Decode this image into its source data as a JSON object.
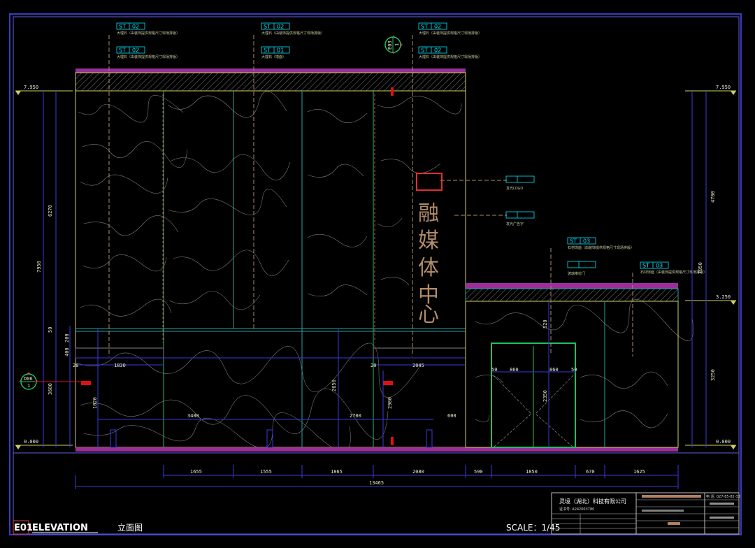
{
  "drawing": {
    "code": "E01",
    "title_en": "ELEVATION",
    "title_cn": "立面图",
    "scale": "SCALE：1/45"
  },
  "big_text": [
    "融",
    "媒",
    "体",
    "中",
    "心"
  ],
  "levels": {
    "top": "7.950",
    "mid": "3.250",
    "ground": "0.000"
  },
  "material_tags": [
    {
      "code": "ST",
      "num": "02",
      "note": "大理石（由装饰提供规格尺寸现场排版）"
    },
    {
      "code": "ST",
      "num": "02",
      "note": "大理石（由装饰提供规格尺寸现场排版）"
    },
    {
      "code": "ST",
      "num": "02",
      "note": "大理石（由装饰提供规格尺寸现场排版）"
    },
    {
      "code": "ST",
      "num": "01",
      "note": "大理石（墙面）"
    },
    {
      "code": "ST",
      "num": "02",
      "note": "大理石（由装饰提供规格尺寸现场排版）"
    },
    {
      "code": "ST",
      "num": "02",
      "note": "大理石（由装饰提供规格尺寸现场排版）"
    },
    {
      "code": "ST",
      "num": "03",
      "note": "石材饰面（由装饰提供规格尺寸现场排版）"
    },
    {
      "code": "ST",
      "num": "03",
      "note": "石材饰面（由装饰提供规格尺寸现场排版）"
    }
  ],
  "callouts": {
    "logo": "发光LOGO",
    "chars": "发光广告字",
    "door": "玻璃推拉门"
  },
  "section_markers": [
    {
      "top": "D06",
      "bottom": "1"
    },
    {
      "top": "E03",
      "bottom": "1"
    }
  ],
  "dims_bottom": [
    "1655",
    "1555",
    "1865",
    "2080",
    "590",
    "1850",
    "670",
    "1625"
  ],
  "dims_total": "13465",
  "dims_left": [
    "6270",
    "7950",
    "3600",
    "50",
    "200",
    "400"
  ],
  "dims_right": [
    "4700",
    "7950",
    "3250"
  ],
  "dims_inner": [
    "1830",
    "2045",
    "3400",
    "2700",
    "600",
    "1020",
    "2650",
    "2900",
    "860",
    "860",
    "2350",
    "520",
    "20",
    "20",
    "50",
    "50"
  ],
  "title_block": {
    "company": "灵境（湖北）科技有限公司",
    "phone": "电 话: 027-85-82-33",
    "license": "证书号: A242003780"
  }
}
